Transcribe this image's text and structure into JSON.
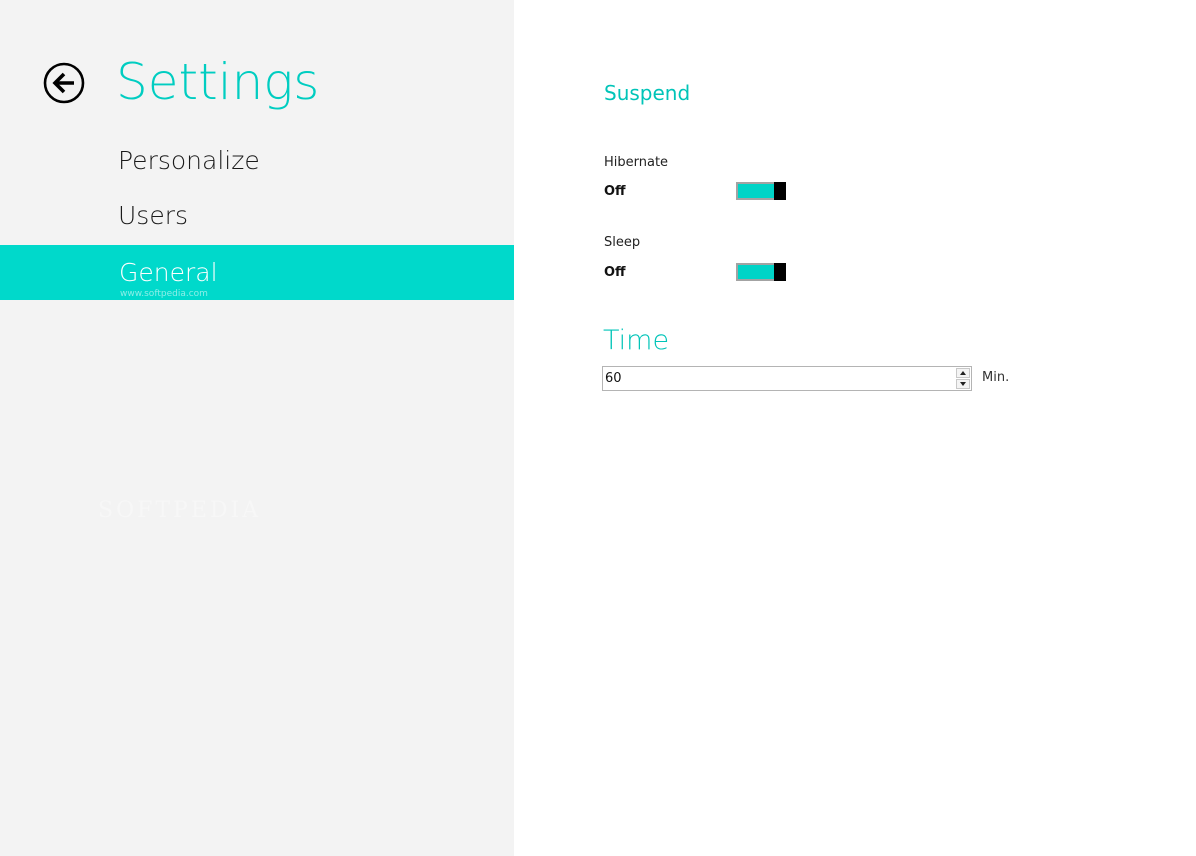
{
  "header": {
    "title": "Settings",
    "back_icon": "arrow-left-circle-icon"
  },
  "nav": {
    "items": [
      {
        "label": "Personalize",
        "selected": false
      },
      {
        "label": "Users",
        "selected": false
      },
      {
        "label": "General",
        "selected": true
      }
    ]
  },
  "watermark": {
    "text": "SOFTPEDIA",
    "sub": "www.softpedia.com"
  },
  "suspend": {
    "title": "Suspend",
    "hibernate": {
      "label": "Hibernate",
      "state": "Off"
    },
    "sleep": {
      "label": "Sleep",
      "state": "Off"
    }
  },
  "time": {
    "title": "Time",
    "value": "60",
    "unit": "Min."
  },
  "colors": {
    "accent": "#00cdc1",
    "selection": "#00d9cb",
    "left_pane_bg": "#f3f3f3",
    "toggle_fill": "#00d4c7",
    "toggle_thumb": "#000000"
  }
}
